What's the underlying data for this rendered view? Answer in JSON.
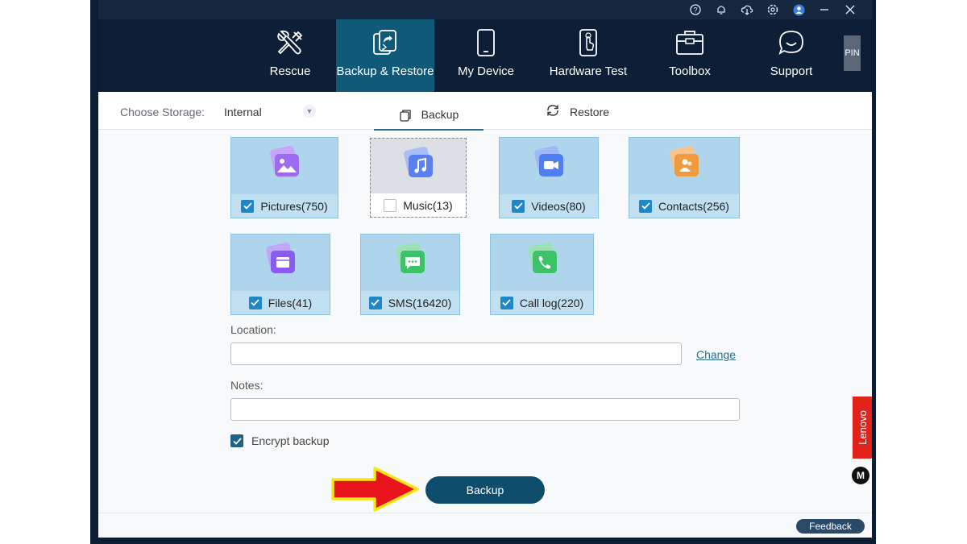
{
  "nav": {
    "items": [
      {
        "label": "Rescue",
        "icon": "tools-icon"
      },
      {
        "label": "Backup & Restore",
        "icon": "backup-restore-icon",
        "active": true
      },
      {
        "label": "My Device",
        "icon": "phone-icon"
      },
      {
        "label": "Hardware Test",
        "icon": "hardware-test-icon"
      },
      {
        "label": "Toolbox",
        "icon": "toolbox-icon"
      },
      {
        "label": "Support",
        "icon": "support-chat-icon"
      }
    ],
    "pin_label": "PIN"
  },
  "storage": {
    "label": "Choose Storage:",
    "value": "Internal"
  },
  "tabs": {
    "backup": "Backup",
    "restore": "Restore"
  },
  "categories": [
    {
      "label": "Pictures(750)",
      "checked": true,
      "icon": "pictures-icon",
      "color": "#9c6bf0"
    },
    {
      "label": "Music(13)",
      "checked": false,
      "icon": "music-icon",
      "color": "#5b7ff0"
    },
    {
      "label": "Videos(80)",
      "checked": true,
      "icon": "video-icon",
      "color": "#4f7df2"
    },
    {
      "label": "Contacts(256)",
      "checked": true,
      "icon": "contacts-icon",
      "color": "#f29a3e"
    },
    {
      "label": "Files(41)",
      "checked": true,
      "icon": "files-icon",
      "color": "#8a5bef"
    },
    {
      "label": "SMS(16420)",
      "checked": true,
      "icon": "sms-icon",
      "color": "#3cc36a"
    },
    {
      "label": "Call log(220)",
      "checked": true,
      "icon": "call-log-icon",
      "color": "#3cc36a"
    }
  ],
  "location": {
    "label": "Location:",
    "value": "",
    "change_label": "Change"
  },
  "notes": {
    "label": "Notes:",
    "value": ""
  },
  "encrypt": {
    "label": "Encrypt backup",
    "checked": true
  },
  "backup_button": "Backup",
  "feedback_button": "Feedback",
  "brand": {
    "lenovo": "Lenovo",
    "moto": "M"
  },
  "colors": {
    "accent": "#0f4d6c",
    "active_nav": "#0e5a78",
    "card_bg": "#aed5eb",
    "checkbox": "#1d87c8"
  }
}
